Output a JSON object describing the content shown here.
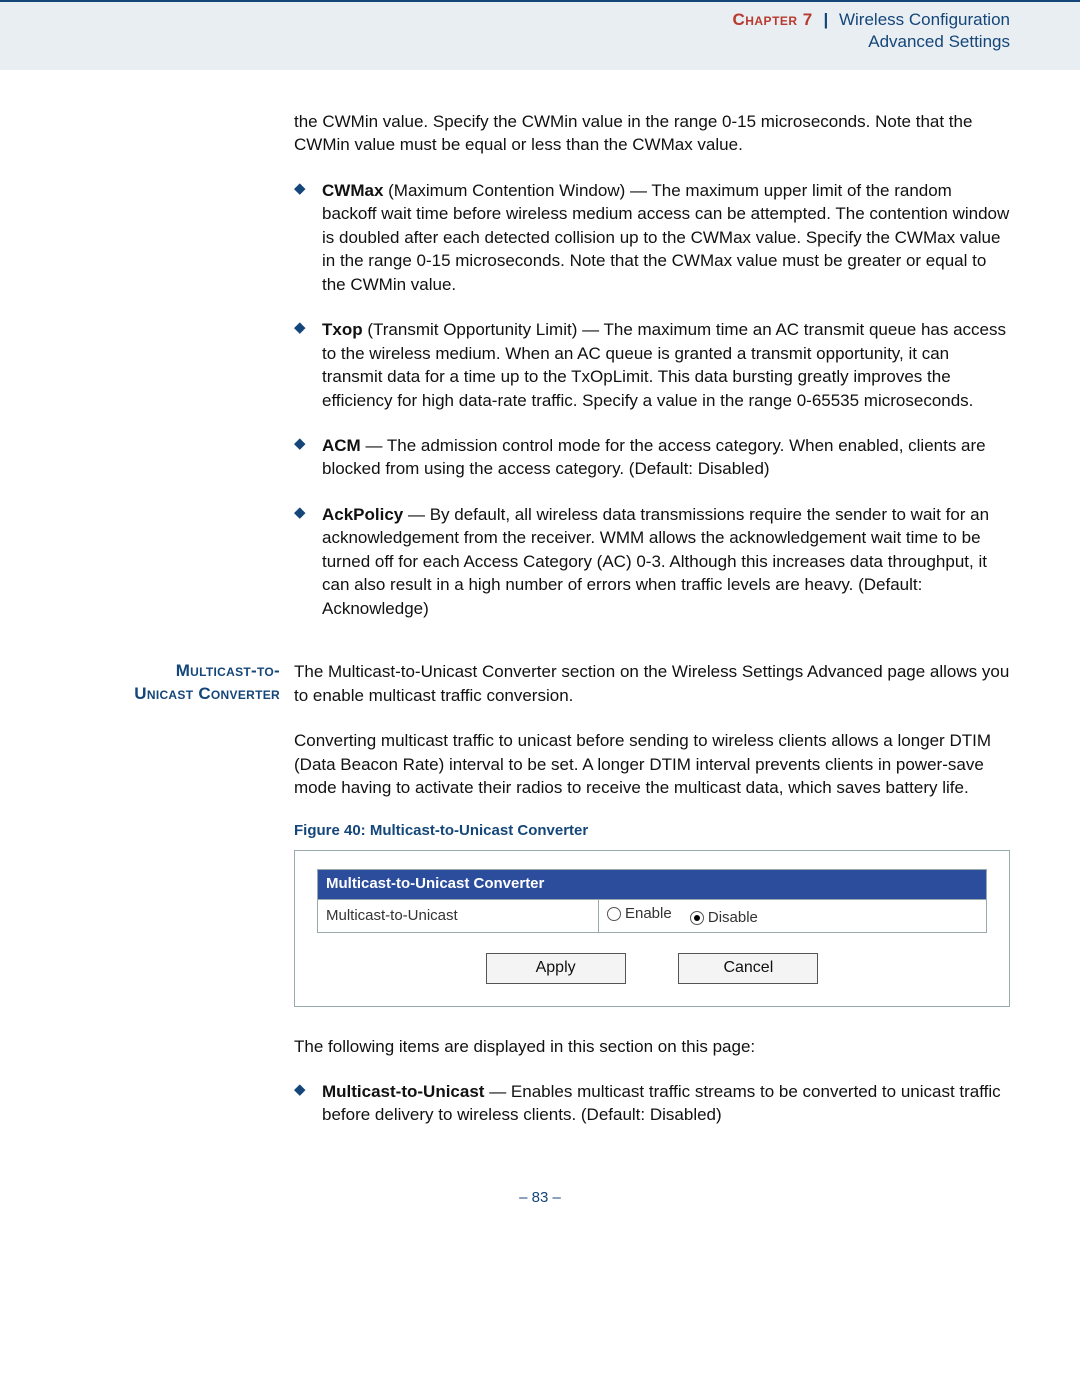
{
  "header": {
    "chapter_label": "Chapter 7",
    "separator": "|",
    "chapter_title": "Wireless Configuration",
    "subtitle": "Advanced Settings"
  },
  "intro_continuation": "the CWMin value. Specify the CWMin value in the range 0-15 microseconds. Note that the CWMin value must be equal or less than the CWMax value.",
  "bullets_top": [
    {
      "term": "CWMax",
      "rest": " (Maximum Contention Window) — The maximum upper limit of the random backoff wait time before wireless medium access can be attempted. The contention window is doubled after each detected collision up to the CWMax value. Specify the CWMax value in the range 0-15 microseconds. Note that the CWMax value must be greater or equal to the CWMin value."
    },
    {
      "term": "Txop",
      "rest": " (Transmit Opportunity Limit) — The maximum time an AC transmit queue has access to the wireless medium. When an AC queue is granted a transmit opportunity, it can transmit data for a time up to the TxOpLimit. This data bursting greatly improves the efficiency for high data-rate traffic. Specify a value in the range 0-65535 microseconds."
    },
    {
      "term": "ACM",
      "rest": " — The admission control mode for the access category. When enabled, clients are blocked from using the access category. (Default: Disabled)"
    },
    {
      "term": "AckPolicy",
      "rest": " — By default, all wireless data transmissions require the sender to wait for an acknowledgement from the receiver. WMM allows the acknowledgement wait time to be turned off for each Access Category (AC) 0-3. Although this increases data throughput, it can also result in a high number of errors when traffic levels are heavy. (Default: Acknowledge)"
    }
  ],
  "side_heading_1": "Multicast-to-",
  "side_heading_2": "Unicast Converter",
  "mc_para1": "The Multicast-to-Unicast Converter section on the Wireless Settings Advanced page allows you to enable multicast traffic conversion.",
  "mc_para2": "Converting multicast traffic to unicast before sending to wireless clients allows a longer DTIM (Data Beacon Rate) interval to be set. A longer DTIM interval prevents clients in power-save mode having to activate their radios to receive the multicast data, which saves battery life.",
  "figure_caption": "Figure 40:  Multicast-to-Unicast Converter",
  "panel": {
    "title": "Multicast-to-Unicast Converter",
    "row_label": "Multicast-to-Unicast",
    "opt_enable": "Enable",
    "opt_disable": "Disable",
    "btn_apply": "Apply",
    "btn_cancel": "Cancel"
  },
  "after_panel": "The following items are displayed in this section on this page:",
  "bullets_bottom": [
    {
      "term": "Multicast-to-Unicast",
      "rest": " — Enables multicast traffic streams to be converted to unicast traffic before delivery to wireless clients. (Default: Disabled)"
    }
  ],
  "page_number": "–  83  –"
}
